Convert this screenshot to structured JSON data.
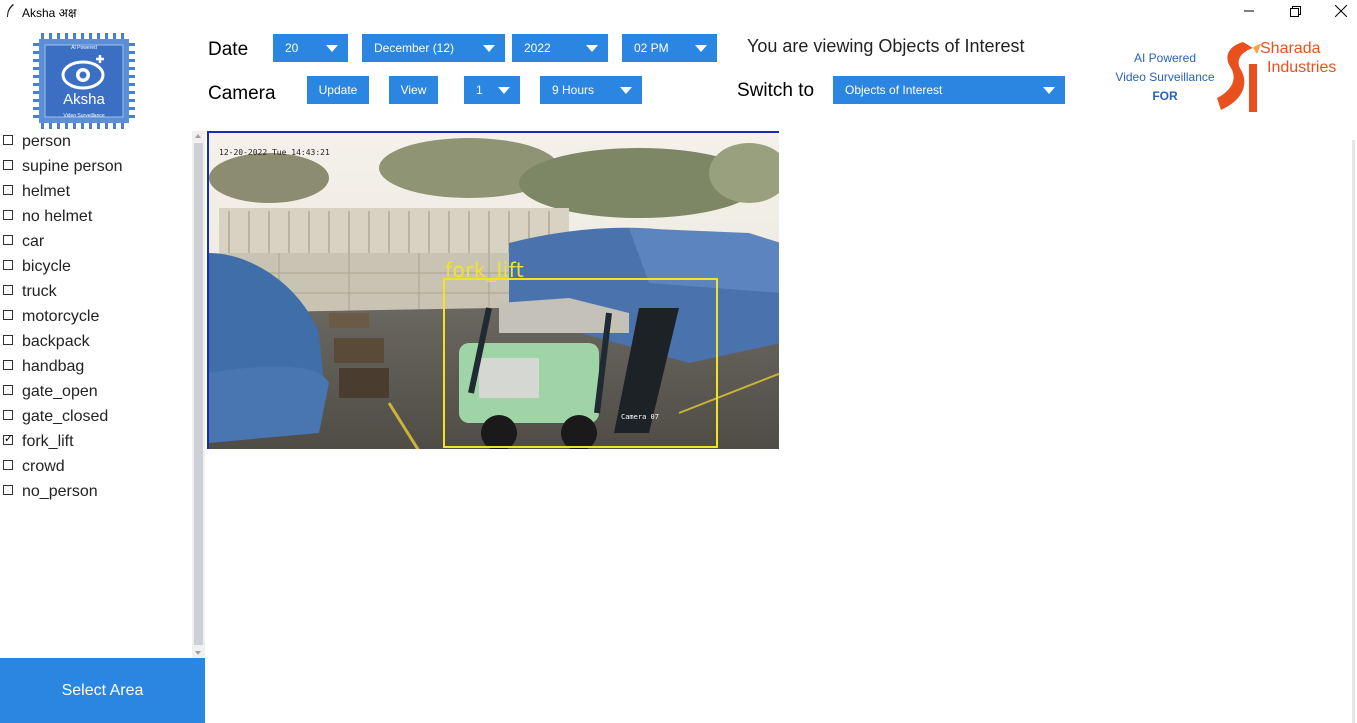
{
  "window": {
    "title": "Aksha  अक्ष",
    "controls": [
      "minimize-icon",
      "restore-icon",
      "close-icon"
    ]
  },
  "logo": {
    "top_text": "AI Powered",
    "name": "Aksha",
    "bottom_text": "Video Surveillance"
  },
  "header": {
    "date_label": "Date",
    "camera_label": "Camera",
    "day": "20",
    "month": "December (12)",
    "year": "2022",
    "hour": "02 PM",
    "update_label": "Update",
    "view_label": "View",
    "camera_number": "1",
    "duration": "9 Hours",
    "viewing_text": "You are viewing Objects of Interest",
    "switch_label": "Switch to",
    "switch_value": "Objects of Interest"
  },
  "brand": {
    "line1": "AI Powered",
    "line2": "Video Surveillance",
    "line3": "FOR",
    "company1": "Sharada",
    "company2": "Industries",
    "accent": "#e8511e",
    "blue": "#2a62b8"
  },
  "objects": [
    {
      "label": "person",
      "checked": false
    },
    {
      "label": "supine person",
      "checked": false
    },
    {
      "label": "helmet",
      "checked": false
    },
    {
      "label": "no helmet",
      "checked": false
    },
    {
      "label": "car",
      "checked": false
    },
    {
      "label": "bicycle",
      "checked": false
    },
    {
      "label": "truck",
      "checked": false
    },
    {
      "label": "motorcycle",
      "checked": false
    },
    {
      "label": "backpack",
      "checked": false
    },
    {
      "label": "handbag",
      "checked": false
    },
    {
      "label": "gate_open",
      "checked": false
    },
    {
      "label": "gate_closed",
      "checked": false
    },
    {
      "label": "fork_lift",
      "checked": true
    },
    {
      "label": "crowd",
      "checked": false
    },
    {
      "label": "no_person",
      "checked": false
    }
  ],
  "select_area_label": "Select Area",
  "camera_view": {
    "timestamp": "12-20-2022 Tue 14:43:21",
    "camera_name": "Camera 07",
    "detection_label": "fork_lift",
    "box_color": "#f2e32a"
  },
  "colors": {
    "accent": "#2a86e0"
  }
}
